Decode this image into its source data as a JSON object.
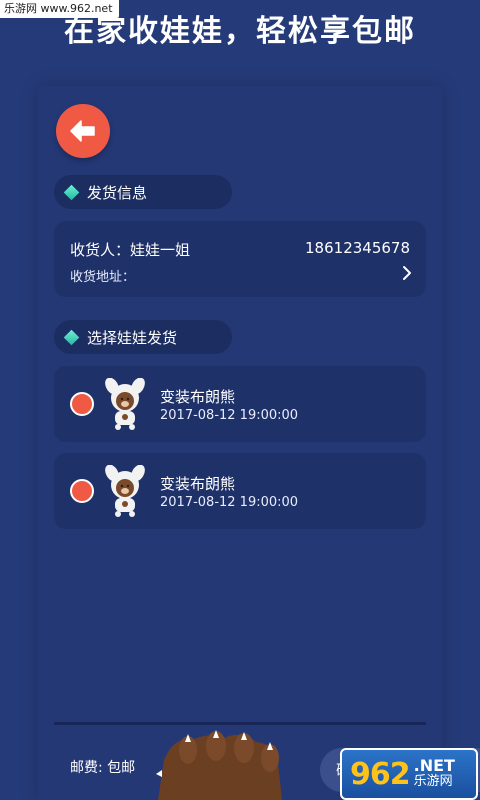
{
  "watermark_top": "乐游网 www.962.net",
  "headline": "在家收娃娃，轻松享包邮",
  "shipping_section": {
    "title": "发货信息",
    "receiver": "收货人：娃娃一姐",
    "phone": "18612345678",
    "address_label": "收货地址："
  },
  "select_section": {
    "title": "选择娃娃发货",
    "items": [
      {
        "name": "变装布朗熊",
        "time": "2017-08-12 19:00:00"
      },
      {
        "name": "变装布朗熊",
        "time": "2017-08-12 19:00:00"
      }
    ]
  },
  "footer": {
    "shipping_fee": "邮费: 包邮",
    "confirm_label": "确"
  },
  "logo": {
    "num": "962",
    "net": ".NET",
    "cn": "乐游网"
  },
  "colors": {
    "background": "#253a78",
    "accent": "#f05a45",
    "card": "#1f3169",
    "diamond": "#3ad0b6"
  },
  "icons": {
    "back": "back-arrow-icon",
    "chevron": "chevron-right-icon",
    "diamond": "diamond-icon"
  }
}
